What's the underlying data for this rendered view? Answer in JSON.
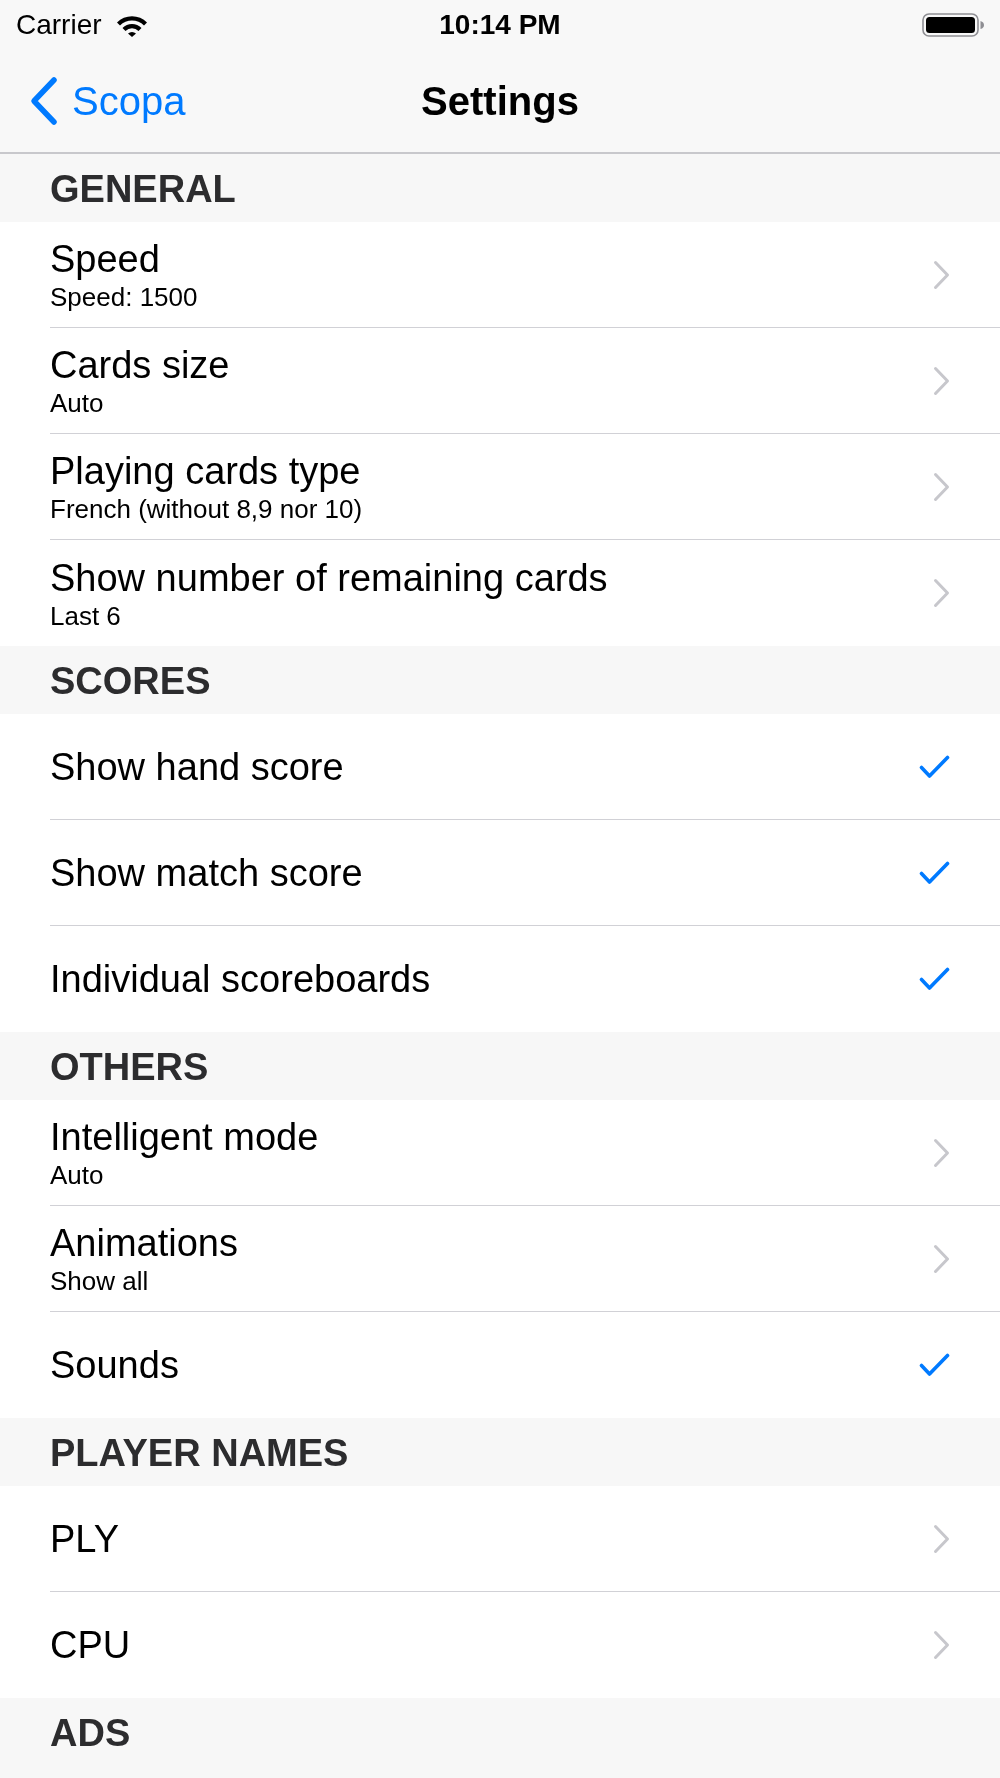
{
  "status_bar": {
    "carrier": "Carrier",
    "time": "10:14 PM"
  },
  "nav_bar": {
    "back": "Scopa",
    "title": "Settings"
  },
  "sections": [
    {
      "title": "GENERAL",
      "items": [
        {
          "kind": "disclosure",
          "title": "Speed",
          "subtitle": "Speed: 1500"
        },
        {
          "kind": "disclosure",
          "title": "Cards size",
          "subtitle": "Auto"
        },
        {
          "kind": "disclosure",
          "title": "Playing cards type",
          "subtitle": "French (without 8,9 nor 10)"
        },
        {
          "kind": "disclosure",
          "title": "Show number of remaining cards",
          "subtitle": "Last 6"
        }
      ]
    },
    {
      "title": "SCORES",
      "items": [
        {
          "kind": "check",
          "title": "Show hand score",
          "checked": true
        },
        {
          "kind": "check",
          "title": "Show match score",
          "checked": true
        },
        {
          "kind": "check",
          "title": "Individual scoreboards",
          "checked": true
        }
      ]
    },
    {
      "title": "OTHERS",
      "items": [
        {
          "kind": "disclosure",
          "title": "Intelligent mode",
          "subtitle": "Auto"
        },
        {
          "kind": "disclosure",
          "title": "Animations",
          "subtitle": "Show all"
        },
        {
          "kind": "check",
          "title": "Sounds",
          "checked": true
        }
      ]
    },
    {
      "title": "PLAYER NAMES",
      "items": [
        {
          "kind": "disclosure",
          "title": "PLY"
        },
        {
          "kind": "disclosure",
          "title": "CPU"
        }
      ]
    },
    {
      "title": "ADS"
    }
  ]
}
